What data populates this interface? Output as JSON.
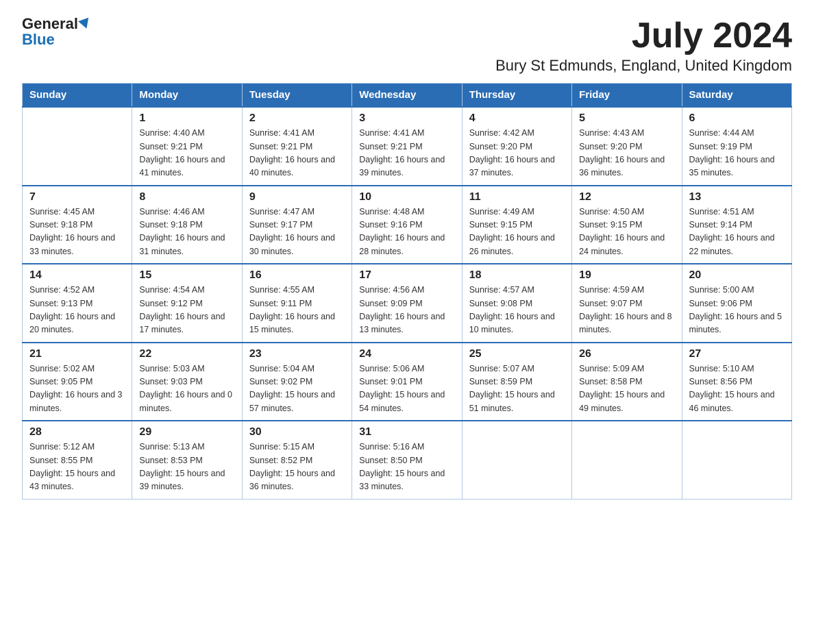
{
  "header": {
    "logo_general": "General",
    "logo_blue": "Blue",
    "month_year": "July 2024",
    "location": "Bury St Edmunds, England, United Kingdom"
  },
  "days_of_week": [
    "Sunday",
    "Monday",
    "Tuesday",
    "Wednesday",
    "Thursday",
    "Friday",
    "Saturday"
  ],
  "weeks": [
    [
      {
        "day": "",
        "info": ""
      },
      {
        "day": "1",
        "info": "Sunrise: 4:40 AM\nSunset: 9:21 PM\nDaylight: 16 hours\nand 41 minutes."
      },
      {
        "day": "2",
        "info": "Sunrise: 4:41 AM\nSunset: 9:21 PM\nDaylight: 16 hours\nand 40 minutes."
      },
      {
        "day": "3",
        "info": "Sunrise: 4:41 AM\nSunset: 9:21 PM\nDaylight: 16 hours\nand 39 minutes."
      },
      {
        "day": "4",
        "info": "Sunrise: 4:42 AM\nSunset: 9:20 PM\nDaylight: 16 hours\nand 37 minutes."
      },
      {
        "day": "5",
        "info": "Sunrise: 4:43 AM\nSunset: 9:20 PM\nDaylight: 16 hours\nand 36 minutes."
      },
      {
        "day": "6",
        "info": "Sunrise: 4:44 AM\nSunset: 9:19 PM\nDaylight: 16 hours\nand 35 minutes."
      }
    ],
    [
      {
        "day": "7",
        "info": "Sunrise: 4:45 AM\nSunset: 9:18 PM\nDaylight: 16 hours\nand 33 minutes."
      },
      {
        "day": "8",
        "info": "Sunrise: 4:46 AM\nSunset: 9:18 PM\nDaylight: 16 hours\nand 31 minutes."
      },
      {
        "day": "9",
        "info": "Sunrise: 4:47 AM\nSunset: 9:17 PM\nDaylight: 16 hours\nand 30 minutes."
      },
      {
        "day": "10",
        "info": "Sunrise: 4:48 AM\nSunset: 9:16 PM\nDaylight: 16 hours\nand 28 minutes."
      },
      {
        "day": "11",
        "info": "Sunrise: 4:49 AM\nSunset: 9:15 PM\nDaylight: 16 hours\nand 26 minutes."
      },
      {
        "day": "12",
        "info": "Sunrise: 4:50 AM\nSunset: 9:15 PM\nDaylight: 16 hours\nand 24 minutes."
      },
      {
        "day": "13",
        "info": "Sunrise: 4:51 AM\nSunset: 9:14 PM\nDaylight: 16 hours\nand 22 minutes."
      }
    ],
    [
      {
        "day": "14",
        "info": "Sunrise: 4:52 AM\nSunset: 9:13 PM\nDaylight: 16 hours\nand 20 minutes."
      },
      {
        "day": "15",
        "info": "Sunrise: 4:54 AM\nSunset: 9:12 PM\nDaylight: 16 hours\nand 17 minutes."
      },
      {
        "day": "16",
        "info": "Sunrise: 4:55 AM\nSunset: 9:11 PM\nDaylight: 16 hours\nand 15 minutes."
      },
      {
        "day": "17",
        "info": "Sunrise: 4:56 AM\nSunset: 9:09 PM\nDaylight: 16 hours\nand 13 minutes."
      },
      {
        "day": "18",
        "info": "Sunrise: 4:57 AM\nSunset: 9:08 PM\nDaylight: 16 hours\nand 10 minutes."
      },
      {
        "day": "19",
        "info": "Sunrise: 4:59 AM\nSunset: 9:07 PM\nDaylight: 16 hours\nand 8 minutes."
      },
      {
        "day": "20",
        "info": "Sunrise: 5:00 AM\nSunset: 9:06 PM\nDaylight: 16 hours\nand 5 minutes."
      }
    ],
    [
      {
        "day": "21",
        "info": "Sunrise: 5:02 AM\nSunset: 9:05 PM\nDaylight: 16 hours\nand 3 minutes."
      },
      {
        "day": "22",
        "info": "Sunrise: 5:03 AM\nSunset: 9:03 PM\nDaylight: 16 hours\nand 0 minutes."
      },
      {
        "day": "23",
        "info": "Sunrise: 5:04 AM\nSunset: 9:02 PM\nDaylight: 15 hours\nand 57 minutes."
      },
      {
        "day": "24",
        "info": "Sunrise: 5:06 AM\nSunset: 9:01 PM\nDaylight: 15 hours\nand 54 minutes."
      },
      {
        "day": "25",
        "info": "Sunrise: 5:07 AM\nSunset: 8:59 PM\nDaylight: 15 hours\nand 51 minutes."
      },
      {
        "day": "26",
        "info": "Sunrise: 5:09 AM\nSunset: 8:58 PM\nDaylight: 15 hours\nand 49 minutes."
      },
      {
        "day": "27",
        "info": "Sunrise: 5:10 AM\nSunset: 8:56 PM\nDaylight: 15 hours\nand 46 minutes."
      }
    ],
    [
      {
        "day": "28",
        "info": "Sunrise: 5:12 AM\nSunset: 8:55 PM\nDaylight: 15 hours\nand 43 minutes."
      },
      {
        "day": "29",
        "info": "Sunrise: 5:13 AM\nSunset: 8:53 PM\nDaylight: 15 hours\nand 39 minutes."
      },
      {
        "day": "30",
        "info": "Sunrise: 5:15 AM\nSunset: 8:52 PM\nDaylight: 15 hours\nand 36 minutes."
      },
      {
        "day": "31",
        "info": "Sunrise: 5:16 AM\nSunset: 8:50 PM\nDaylight: 15 hours\nand 33 minutes."
      },
      {
        "day": "",
        "info": ""
      },
      {
        "day": "",
        "info": ""
      },
      {
        "day": "",
        "info": ""
      }
    ]
  ]
}
